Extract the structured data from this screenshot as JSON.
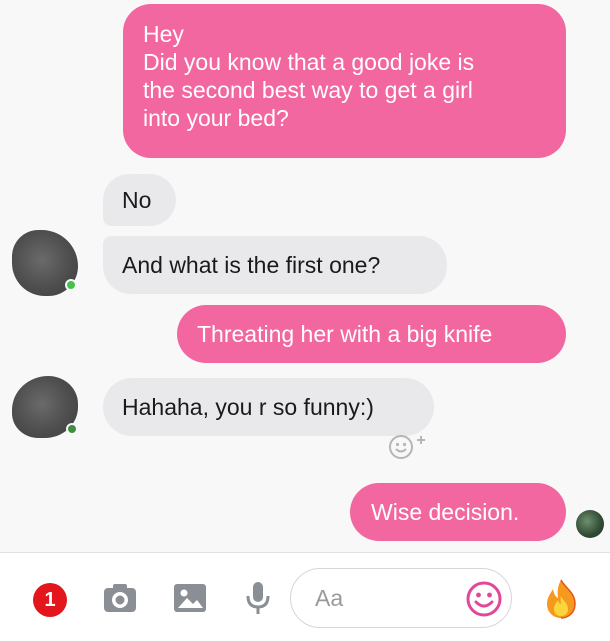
{
  "messages": [
    {
      "direction": "outgoing",
      "text": "Hey\nDid you know that a good joke is\nthe second best way to get a girl\ninto your bed?"
    },
    {
      "direction": "incoming",
      "text": "No"
    },
    {
      "direction": "incoming",
      "text": "And what is the first one?"
    },
    {
      "direction": "outgoing",
      "text": "Threating her with a big knife"
    },
    {
      "direction": "incoming",
      "text": "Hahaha, you r so funny:)"
    },
    {
      "direction": "outgoing",
      "text": "Wise decision."
    }
  ],
  "composer": {
    "notification_count": "1",
    "placeholder": "Aa",
    "icons": [
      "camera-icon",
      "image-icon",
      "microphone-icon",
      "emoji-icon",
      "fire-icon"
    ]
  },
  "colors": {
    "outgoing_bubble": "#f2679f",
    "incoming_bubble": "#e9e9eb",
    "badge": "#e2161c",
    "toolbar_icon": "#8a8f96",
    "emoji_accent": "#e2479a",
    "online": "#44c24a"
  }
}
